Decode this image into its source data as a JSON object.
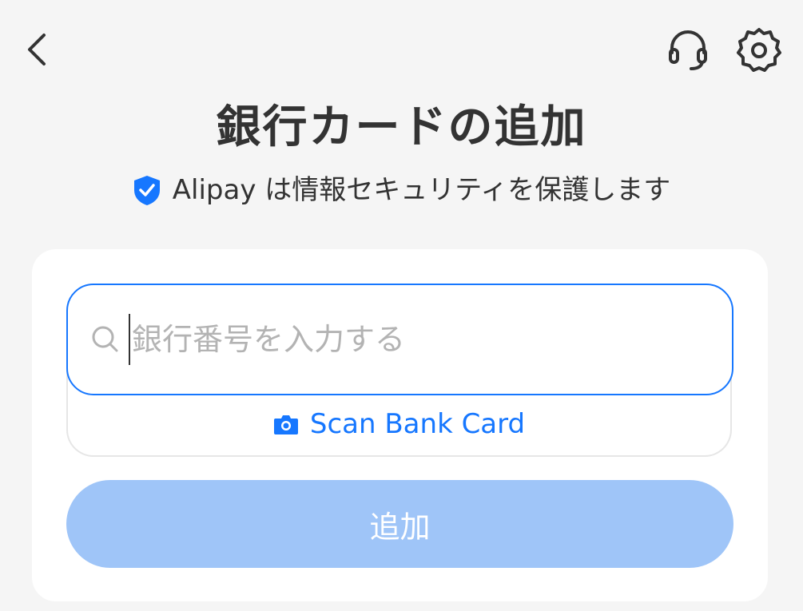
{
  "nav": {
    "back_icon": "chevron-left-icon",
    "support_icon": "headset-icon",
    "settings_icon": "gear-icon"
  },
  "header": {
    "title": "銀行カードの追加",
    "subtitle": "Alipay は情報セキュリティを保護します",
    "shield_icon": "shield-check-icon"
  },
  "form": {
    "search_placeholder": "銀行番号を入力する",
    "search_value": "",
    "search_icon": "search-icon",
    "scan_label": "Scan Bank Card",
    "scan_icon": "camera-icon",
    "submit_label": "追加"
  },
  "colors": {
    "accent": "#1677ff",
    "button_disabled": "#9fc5f8",
    "background": "#f5f5f5",
    "text": "#333333"
  }
}
